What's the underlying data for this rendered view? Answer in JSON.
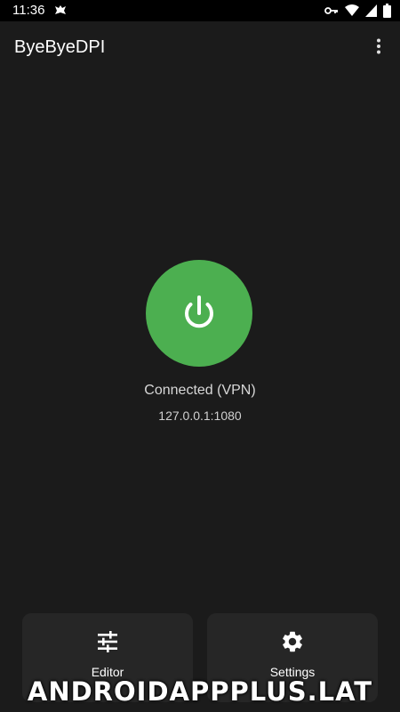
{
  "status_bar": {
    "time": "11:36",
    "icons": [
      "app-notification-icon",
      "vpn-key-icon",
      "wifi-icon",
      "cellular-icon",
      "battery-icon"
    ]
  },
  "app_bar": {
    "title": "ByeByeDPI",
    "menu_icon": "more-vert-icon"
  },
  "connection": {
    "status": "Connected (VPN)",
    "address": "127.0.0.1:1080",
    "button_icon": "power-icon",
    "accent_color": "#4caf50"
  },
  "bottom_actions": [
    {
      "label": "Editor",
      "icon": "tune-sliders-icon"
    },
    {
      "label": "Settings",
      "icon": "gear-icon"
    }
  ],
  "watermark": "ANDROIDAPPPLUS.LAT",
  "colors": {
    "background": "#1b1b1b",
    "card": "#262626",
    "accent": "#4caf50"
  }
}
